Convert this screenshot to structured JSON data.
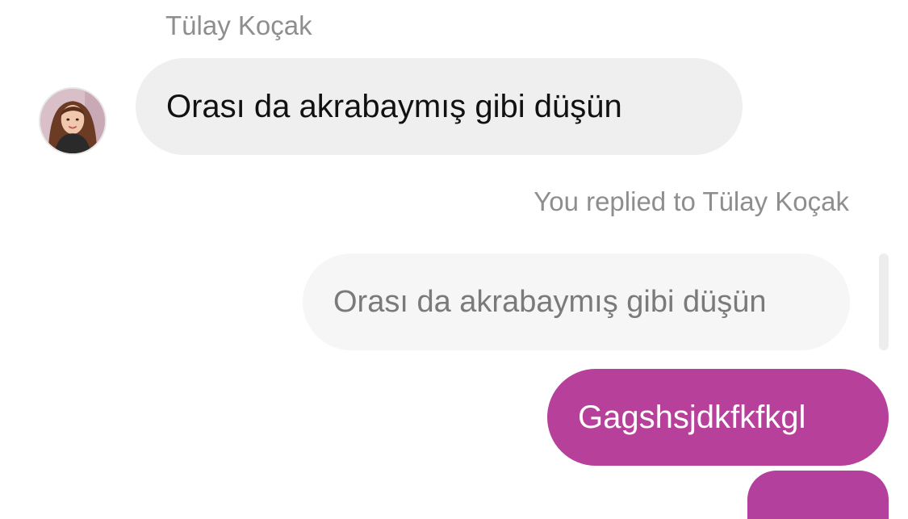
{
  "conversation": {
    "sender_name": "Tülay Koçak",
    "incoming_message": "Orası da akrabaymış gibi düşün",
    "reply_label": "You replied to Tülay Koçak",
    "quoted_message": "Orası da akrabaymış gibi düşün",
    "outgoing_message": "Gagshsjdkfkfkgl"
  },
  "colors": {
    "incoming_bubble": "#efefef",
    "quoted_bubble": "#f6f6f6",
    "outgoing_bubble": "#b7409a",
    "meta_text": "#8e8e8e"
  },
  "icons": {
    "avatar": "user-avatar-photo"
  }
}
